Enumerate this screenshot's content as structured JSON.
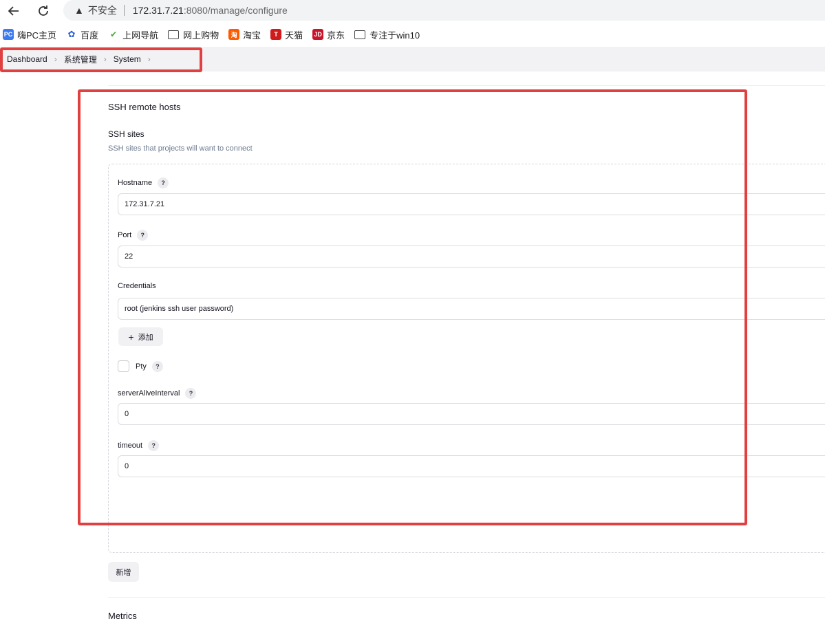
{
  "browser": {
    "insecure_label": "不安全",
    "url_host": "172.31.7.21",
    "url_path": ":8080/manage/configure"
  },
  "bookmarks": [
    {
      "label": "嗨PC主页",
      "icon": "hipc-icon",
      "color": "#3a7bf2"
    },
    {
      "label": "百度",
      "icon": "baidu-paw-icon",
      "color": "#2a5fd8"
    },
    {
      "label": "上网导航",
      "icon": "hao123-icon",
      "color": "#46a832"
    },
    {
      "label": "网上购物",
      "icon": "folder-icon",
      "color": ""
    },
    {
      "label": "淘宝",
      "icon": "taobao-icon",
      "color": "#ff5a00"
    },
    {
      "label": "天猫",
      "icon": "tmall-icon",
      "color": "#d11a1a"
    },
    {
      "label": "京东",
      "icon": "jd-icon",
      "color": "#c8152b"
    },
    {
      "label": "专注于win10",
      "icon": "folder-icon",
      "color": ""
    }
  ],
  "breadcrumb": [
    "Dashboard",
    "系统管理",
    "System"
  ],
  "ssh": {
    "section_title": "SSH remote hosts",
    "sites_label": "SSH sites",
    "sites_desc": "SSH sites that projects will want to connect",
    "hostname_label": "Hostname",
    "hostname_value": "172.31.7.21",
    "port_label": "Port",
    "port_value": "22",
    "credentials_label": "Credentials",
    "credentials_value": "root (jenkins ssh user password)",
    "add_label": "添加",
    "pty_label": "Pty",
    "alive_label": "serverAliveInterval",
    "alive_value": "0",
    "timeout_label": "timeout",
    "timeout_value": "0",
    "new_label": "新增",
    "help_glyph": "?"
  },
  "next_section": "Metrics",
  "colors": {
    "highlight": "#e04040"
  }
}
